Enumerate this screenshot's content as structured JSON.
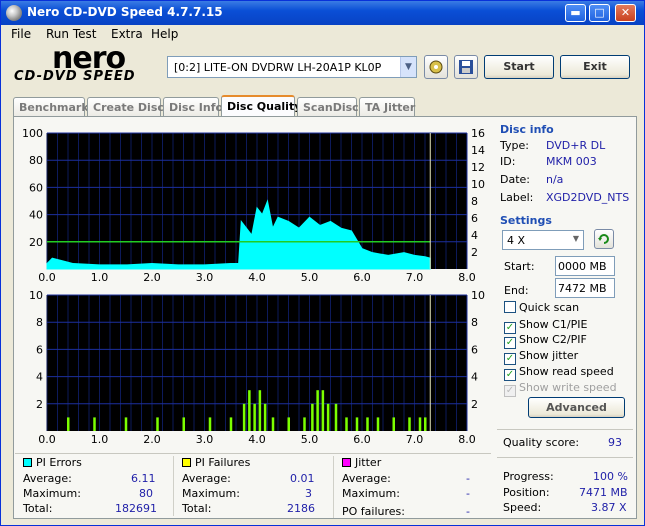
{
  "window": {
    "title": "Nero CD-DVD Speed 4.7.7.15",
    "minimize": "▬",
    "maximize": "□",
    "close": "✕"
  },
  "menu": [
    "File",
    "Run Test",
    "Extra",
    "Help"
  ],
  "logo": {
    "brand": "nero",
    "product": "CD-DVD SPEED"
  },
  "toolbar": {
    "drive": "[0:2]  LITE-ON DVDRW LH-20A1P KL0P",
    "start_label": "Start",
    "exit_label": "Exit"
  },
  "tabs": [
    "Benchmark",
    "Create Disc",
    "Disc Info",
    "Disc Quality",
    "ScanDisc",
    "TA Jitter"
  ],
  "active_tab": "Disc Quality",
  "disc_info": {
    "title": "Disc info",
    "type_key": "Type:",
    "type": "DVD+R DL",
    "id_key": "ID:",
    "id": "MKM 003",
    "date_key": "Date:",
    "date": "n/a",
    "label_key": "Label:",
    "label": "XGD2DVD_NTS"
  },
  "settings": {
    "title": "Settings",
    "speed": "4 X",
    "start_key": "Start:",
    "start": "0000 MB",
    "end_key": "End:",
    "end": "7472 MB",
    "quick_scan": "Quick scan",
    "show_c1": "Show C1/PIE",
    "show_c2": "Show C2/PIF",
    "show_jitter": "Show jitter",
    "show_read": "Show read speed",
    "show_write": "Show write speed",
    "advanced_label": "Advanced"
  },
  "quality": {
    "label": "Quality score:",
    "value": "93"
  },
  "progress": {
    "progress_key": "Progress:",
    "progress": "100 %",
    "position_key": "Position:",
    "position": "7471 MB",
    "speed_key": "Speed:",
    "speed": "3.87 X"
  },
  "pi_errors": {
    "title": "PI Errors",
    "average_key": "Average:",
    "average": "6.11",
    "maximum_key": "Maximum:",
    "maximum": "80",
    "total_key": "Total:",
    "total": "182691",
    "color": "#00ffff"
  },
  "pi_failures": {
    "title": "PI Failures",
    "average_key": "Average:",
    "average": "0.01",
    "maximum_key": "Maximum:",
    "maximum": "3",
    "total_key": "Total:",
    "total": "2186",
    "color": "#ffff00"
  },
  "jitter": {
    "title": "Jitter",
    "average_key": "Average:",
    "average": "-",
    "maximum_key": "Maximum:",
    "maximum": "-",
    "po_key": "PO failures:",
    "po": "-",
    "color": "#ff00ff"
  },
  "chart_data": [
    {
      "type": "area",
      "x_ticks": [
        "0.0",
        "1.0",
        "2.0",
        "3.0",
        "4.0",
        "5.0",
        "6.0",
        "7.0",
        "8.0"
      ],
      "y_left_ticks": [
        "100",
        "80",
        "60",
        "40",
        "20"
      ],
      "y_right_ticks": [
        "16",
        "14",
        "12",
        "10",
        "8",
        "6",
        "4",
        "2"
      ],
      "xlim": [
        0,
        8
      ],
      "ylim": [
        0,
        100
      ],
      "series": [
        {
          "values_x": [
            0.0,
            0.1,
            0.3,
            0.5,
            1.0,
            1.5,
            2.0,
            2.5,
            3.0,
            3.5,
            3.65,
            3.7,
            3.8,
            3.9,
            4.0,
            4.1,
            4.2,
            4.3,
            4.4,
            4.6,
            4.8,
            5.0,
            5.2,
            5.4,
            5.6,
            5.8,
            6.0,
            6.2,
            6.5,
            6.8,
            7.0,
            7.2,
            7.3
          ],
          "values_y": [
            4,
            8,
            6,
            4,
            3,
            3,
            4,
            3,
            3,
            4,
            4,
            35,
            30,
            25,
            45,
            40,
            50,
            30,
            38,
            35,
            30,
            38,
            32,
            35,
            30,
            28,
            15,
            12,
            10,
            12,
            10,
            9,
            8
          ]
        },
        {
          "values_x": [
            0.0,
            7.3
          ],
          "values_y": [
            4,
            4
          ]
        }
      ],
      "grid": true
    },
    {
      "type": "bar",
      "x_ticks": [
        "0.0",
        "1.0",
        "2.0",
        "3.0",
        "4.0",
        "5.0",
        "6.0",
        "7.0",
        "8.0"
      ],
      "y_left_ticks": [
        "10",
        "8",
        "6",
        "4",
        "2"
      ],
      "y_right_ticks": [
        "10",
        "8",
        "6",
        "4",
        "2"
      ],
      "xlim": [
        0,
        8
      ],
      "ylim": [
        0,
        10
      ],
      "x": [
        0.4,
        0.9,
        1.5,
        2.1,
        2.6,
        3.1,
        3.5,
        3.75,
        3.85,
        3.95,
        4.05,
        4.15,
        4.3,
        4.6,
        4.9,
        5.05,
        5.15,
        5.25,
        5.35,
        5.5,
        5.7,
        5.9,
        6.1,
        6.3,
        6.6,
        6.9,
        7.1,
        7.2
      ],
      "values": [
        1,
        1,
        1,
        1,
        1,
        1,
        1,
        2,
        3,
        2,
        3,
        2,
        1,
        1,
        1,
        2,
        3,
        3,
        2,
        2,
        1,
        1,
        1,
        1,
        1,
        1,
        1,
        1
      ],
      "grid": true
    }
  ]
}
